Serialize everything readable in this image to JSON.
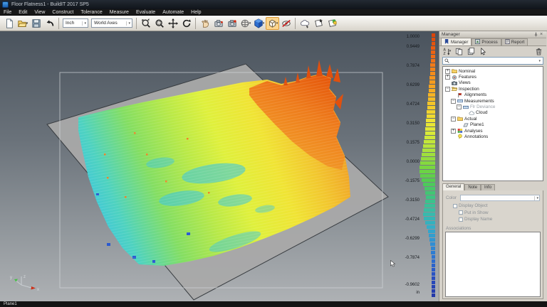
{
  "window": {
    "title": "Floor Flatness1 - BuildIT 2017 SP5",
    "status_text": "Plane1"
  },
  "menu_bar": [
    "File",
    "Edit",
    "View",
    "Construct",
    "Tolerance",
    "Measure",
    "Evaluate",
    "Automate",
    "Help"
  ],
  "toolbar": {
    "unit_value": "Inch",
    "axes_value": "World Axes",
    "items": [
      {
        "type": "btn",
        "name": "new-document"
      },
      {
        "type": "btn",
        "name": "open-document",
        "caret": true
      },
      {
        "type": "btn",
        "name": "save-document"
      },
      {
        "type": "btn",
        "name": "undo"
      },
      {
        "type": "sep"
      },
      {
        "type": "combo",
        "name": "unit-select",
        "bind": "unit_value",
        "width": 36
      },
      {
        "type": "combo",
        "name": "axes-select",
        "bind": "axes_value",
        "width": 58
      },
      {
        "type": "sep"
      },
      {
        "type": "btn",
        "name": "zoom-window"
      },
      {
        "type": "btn",
        "name": "zoom-selection"
      },
      {
        "type": "btn",
        "name": "pan-view"
      },
      {
        "type": "btn",
        "name": "rotate-view"
      },
      {
        "type": "sep"
      },
      {
        "type": "btn",
        "name": "grab-view"
      },
      {
        "type": "btn",
        "name": "capture-image"
      },
      {
        "type": "btn",
        "name": "record-video"
      },
      {
        "type": "btn",
        "name": "render-mode",
        "caret": true
      },
      {
        "type": "btn",
        "name": "shaded-view",
        "caret": true
      },
      {
        "type": "btn",
        "name": "box-view",
        "caret": true,
        "active": true
      },
      {
        "type": "btn",
        "name": "hide-object"
      },
      {
        "type": "sep"
      },
      {
        "type": "btn",
        "name": "cloud-tool"
      },
      {
        "type": "btn",
        "name": "polygon-star-tool"
      },
      {
        "type": "btn",
        "name": "polygon-fill-tool"
      }
    ]
  },
  "viewport": {
    "axis_labels": {
      "x": "x",
      "y": "y",
      "z": "z"
    }
  },
  "colorbar": {
    "unit": "in",
    "ticks": [
      "1.0000",
      "0.9449",
      "0.7874",
      "0.6299",
      "0.4724",
      "0.3150",
      "0.1575",
      "0.0000",
      "-0.1575",
      "-0.3150",
      "-0.4724",
      "-0.6299",
      "-0.7874",
      "-0.9602"
    ],
    "color_stops": [
      [
        0,
        "#dc4408"
      ],
      [
        0.05,
        "#ea5c10"
      ],
      [
        0.1,
        "#f07418"
      ],
      [
        0.16,
        "#f4921c"
      ],
      [
        0.22,
        "#f6b024"
      ],
      [
        0.28,
        "#f2cc2c"
      ],
      [
        0.33,
        "#eee434"
      ],
      [
        0.38,
        "#d8ea38"
      ],
      [
        0.44,
        "#aee23c"
      ],
      [
        0.5,
        "#7ed83e"
      ],
      [
        0.56,
        "#52cc50"
      ],
      [
        0.62,
        "#3ec47e"
      ],
      [
        0.68,
        "#38bca8"
      ],
      [
        0.74,
        "#34acc8"
      ],
      [
        0.8,
        "#3090d4"
      ],
      [
        0.86,
        "#2c70d0"
      ],
      [
        0.92,
        "#2a52c4"
      ],
      [
        1,
        "#2438a8"
      ]
    ],
    "hist": [
      5,
      5,
      5,
      6,
      6,
      6,
      6,
      7,
      7,
      7,
      8,
      8,
      9,
      9,
      10,
      10,
      11,
      11,
      12,
      12,
      13,
      13,
      14,
      14,
      15,
      16,
      17,
      18,
      19,
      20,
      21,
      22,
      22,
      21,
      19,
      17,
      15,
      14,
      13,
      14,
      15,
      16,
      17,
      16,
      14,
      12,
      10,
      9,
      8,
      7,
      6,
      6,
      5,
      5,
      5,
      5,
      5,
      5,
      5,
      5,
      5,
      5
    ]
  },
  "manager": {
    "title": "Manager",
    "tabs": [
      {
        "label": "Manager",
        "icon": "manager-tab-icon",
        "active": true
      },
      {
        "label": "Process",
        "icon": "process-tab-icon",
        "active": false
      },
      {
        "label": "Report",
        "icon": "report-tab-icon",
        "active": false
      }
    ],
    "tools": [
      "sort-az",
      "copy-item",
      "duplicate-item",
      "select-arrow"
    ],
    "trash_tool": "delete-item",
    "search_value": "",
    "tree": [
      {
        "label": "Nominal",
        "level": 0,
        "expand": "+",
        "icon": "folder"
      },
      {
        "label": "Features",
        "level": 0,
        "expand": "+",
        "icon": "features"
      },
      {
        "label": "Views",
        "level": 0,
        "expand": null,
        "icon": "camera"
      },
      {
        "label": "Inspection",
        "level": 0,
        "expand": "-",
        "icon": "folder-open"
      },
      {
        "label": "Alignments",
        "level": 1,
        "expand": null,
        "icon": "flag"
      },
      {
        "label": "Measurements",
        "level": 1,
        "expand": "-",
        "icon": "measure"
      },
      {
        "label": "Flr Deviance",
        "level": 2,
        "expand": "-",
        "icon": "measure",
        "dim": true
      },
      {
        "label": "Cloud",
        "level": 3,
        "expand": null,
        "icon": "cloud"
      },
      {
        "label": "Actual",
        "level": 1,
        "expand": "-",
        "icon": "folder"
      },
      {
        "label": "Plane1",
        "level": 2,
        "expand": null,
        "icon": "plane"
      },
      {
        "label": "Analyses",
        "level": 1,
        "expand": "+",
        "icon": "analyses"
      },
      {
        "label": "Annotations",
        "level": 1,
        "expand": null,
        "icon": "annotation"
      }
    ],
    "detail_tabs": [
      "General",
      "Note",
      "Info"
    ],
    "general": {
      "color_label": "Color",
      "checkboxes": [
        {
          "label": "Display Object",
          "indent": 0
        },
        {
          "label": "Put in Show",
          "indent": 1
        },
        {
          "label": "Display Name",
          "indent": 1
        }
      ],
      "associations_label": "Associations"
    }
  }
}
